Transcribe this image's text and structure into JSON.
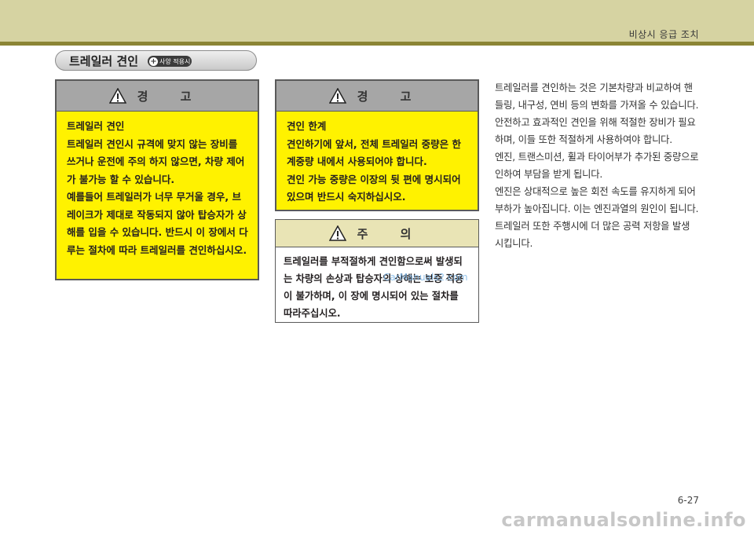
{
  "header": {
    "chapter_title": "비상시 응급 조치"
  },
  "section": {
    "title": "트레일러 견인",
    "badge": "사양 적용시"
  },
  "warning_left": {
    "heading": "경 고",
    "lines": [
      "트레일러 견인",
      "트레일러 견인시 규격에 맞지 않는 장비를 쓰거나 운전에 주의 하지 않으면, 차량 제어가 불가능 할 수 있습니다.",
      "예를들어 트레일러가 너무 무거울 경우, 브레이크가 제대로 작동되지 않아 탑승자가 상해를 입을 수 있습니다. 반드시 이 장에서 다루는 절차에 따라 트레일러를 견인하십시오."
    ]
  },
  "warning_right": {
    "heading": "경 고",
    "lines": [
      "견인 한계",
      "견인하기에 앞서, 전체 트레일러 중량은 한계중량 내에서 사용되어야 합니다.",
      "견인 가능 중량은 이장의 뒷 편에 명시되어 있으며 반드시 숙지하십시오."
    ]
  },
  "caution": {
    "heading": "주 의",
    "text": "트레일러를 부적절하게 견인함으로써 발생되는 차량의 손상과 탑승자의 상해는 보증 적용이 불가하며, 이 장에 명시되어 있는 절차를 따라주십시오."
  },
  "body": {
    "paragraphs": [
      "트레일러를 견인하는 것은 기본차량과 비교하여 핸들링, 내구성, 연비 등의 변화를 가져올 수 있습니다. 안전하고 효과적인 견인을 위해 적절한 장비가 필요하며, 이들 또한 적절하게 사용하여야 합니다.",
      "엔진, 트랜스미션, 휠과 타이어부가 추가된 중량으로 인하여 부담을 받게 됩니다.",
      "엔진은 상대적으로 높은 회전 속도를 유지하게 되어 부하가 높아집니다. 이는 엔진과열의 원인이 됩니다.",
      "트레일러 또한 주행시에 더 많은 공력 저항을 발생 시킵니다."
    ]
  },
  "footer": {
    "page_number": "6-27",
    "watermark_mid": "CarManuals2.com",
    "watermark_bottom": "carmanualsonline.info"
  },
  "colors": {
    "header_band": "#d6d3a2",
    "header_line": "#8b8535",
    "warning_fill": "#fff200",
    "warning_head": "#a6a6a6",
    "caution_head": "#e9e4b5"
  },
  "icons": {
    "warning": "warning-triangle-icon",
    "option": "plus-circle-icon"
  }
}
